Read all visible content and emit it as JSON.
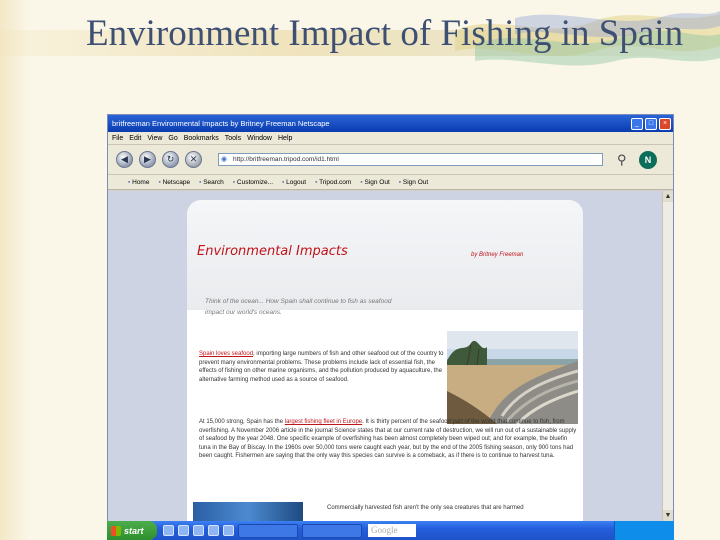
{
  "slide": {
    "title": "Environment Impact of Fishing in Spain"
  },
  "browser": {
    "window_title": "britfreeman   Environmental Impacts          by Britney Freeman    Netscape",
    "menu": [
      "File",
      "Edit",
      "View",
      "Go",
      "Bookmarks",
      "Tools",
      "Window",
      "Help"
    ],
    "url": "http://britfreeman.tripod.com/id1.html",
    "bookmarks": [
      "Home",
      "Netscape",
      "Search",
      "Customize...",
      "Logout",
      "Tripod.com",
      "Sign Out",
      "Sign Out"
    ],
    "window_buttons": {
      "minimize": "_",
      "maximize": "□",
      "close": "×"
    }
  },
  "page": {
    "title": "Environmental Impacts",
    "byline": "by Britney Freeman",
    "intro": "Think of the ocean... How Spain shall continue to fish as seafood impact our world's oceans.",
    "p1_link": "Spain loves seafood",
    "p1_text": ", importing large numbers of fish and other seafood out of the country to prevent many environmental problems. These problems include lack of essential fish, the effects of fishing on other marine organisms, and the pollution produced by aquaculture, the alternative farming method used as a source of seafood.",
    "p2_lead": "At 15,000 strong, Spain has the ",
    "p2_link": "largest fishing fleet in Europe",
    "p2_text": ". It is thirty percent of the seafood part of the world that continue to fish, from overfishing. A November 2006 article in the journal Science states that at our current rate of destruction, we will run out of a sustainable supply of seafood by the year 2048. One specific example of overfishing has been almost completely been wiped out; and for example, the bluefin tuna in the Bay of Biscay. In the 1960s over 50,000 tons were caught each year, but by the end of the 2005 fishing season, only 900 tons had been caught. Fishermen are saying that the only way this species can survive is a comeback, as if there is to continue to harvest tuna.",
    "p3_text": "Commercially harvested fish aren't the only sea creatures that are harmed"
  },
  "taskbar": {
    "start_label": "start",
    "search_box": "Google",
    "tasks": [
      "",
      ""
    ]
  }
}
